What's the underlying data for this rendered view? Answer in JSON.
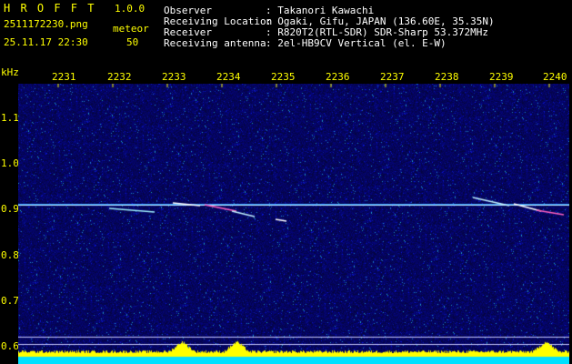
{
  "app": {
    "title": "H R O F F T",
    "version": "1.0.0",
    "filename": "2511172230.png",
    "datetime": "25.11.17 22:30",
    "counter_label": "meteor",
    "counter_value": "50"
  },
  "info": {
    "rows": [
      {
        "label": "Observer",
        "value": ": Takanori Kawachi"
      },
      {
        "label": "Receiving Location",
        "value": ": Ogaki, Gifu, JAPAN (136.60E, 35.35N)"
      },
      {
        "label": "Receiver",
        "value": ": R820T2(RTL-SDR) SDR-Sharp 53.372MHz"
      },
      {
        "label": "Receiving antenna",
        "value": ": 2el-HB9CV Vertical (el. E-W)"
      }
    ]
  },
  "axis": {
    "unit": "kHz",
    "x_ticks": [
      "2231",
      "2232",
      "2233",
      "2234",
      "2235",
      "2236",
      "2237",
      "2238",
      "2239",
      "2240"
    ],
    "y_ticks": [
      "1.1",
      "1.0",
      "0.9",
      "0.8",
      "0.7",
      "0.6"
    ]
  },
  "colors": {
    "label": "#ffff00",
    "text": "#ffffff",
    "background": "#000000",
    "spectrum_noise": "#0a0a80",
    "carrier": "#40c0ff",
    "activity_bar": "#00e0ff",
    "activity_peak": "#ffff00"
  }
}
